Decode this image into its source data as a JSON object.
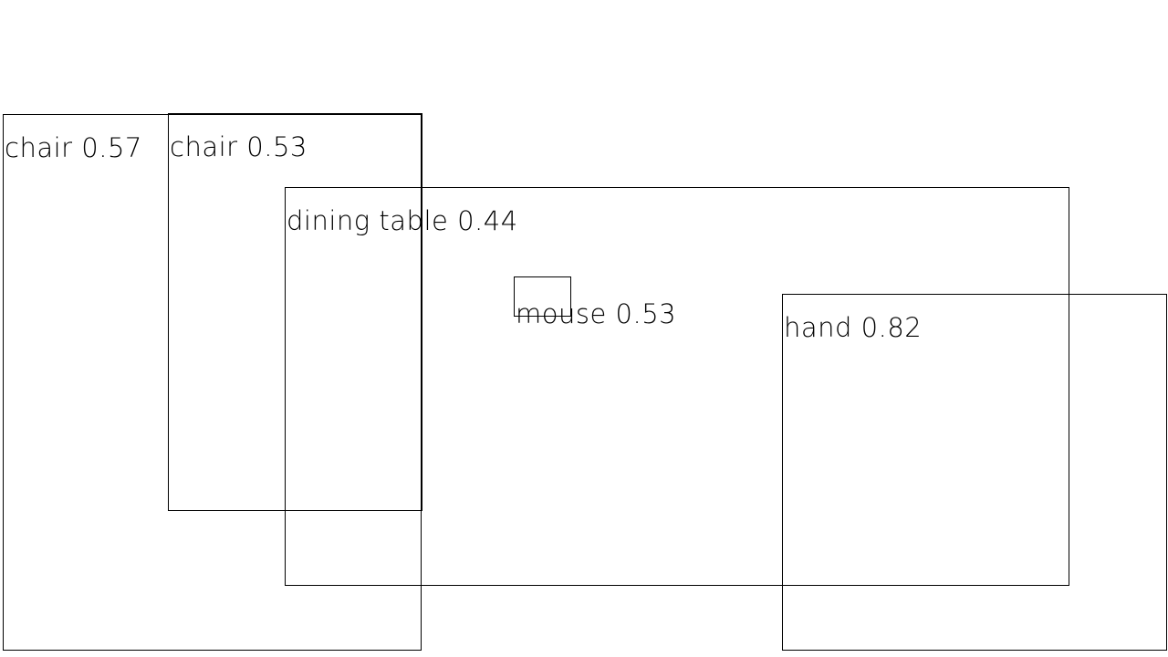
{
  "detections": [
    {
      "label": "chair",
      "score": "0.57",
      "text": "chair 0.57"
    },
    {
      "label": "chair",
      "score": "0.53",
      "text": "chair 0.53"
    },
    {
      "label": "dining table",
      "score": "0.44",
      "text": "dining table 0.44"
    },
    {
      "label": "mouse",
      "score": "0.53",
      "text": "mouse 0.53"
    },
    {
      "label": "hand",
      "score": "0.82",
      "text": "hand 0.82"
    }
  ],
  "colors": {
    "background": "#ffffff",
    "box_stroke": "#000000",
    "label_text": "#000000"
  }
}
